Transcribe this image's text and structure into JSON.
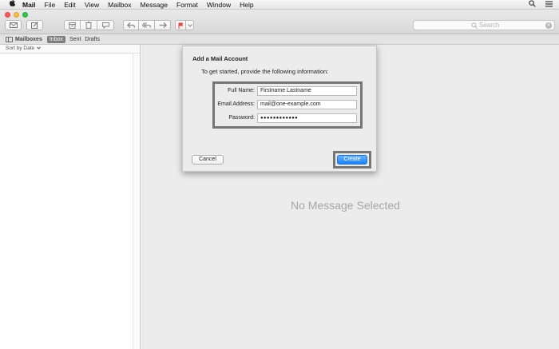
{
  "menubar": {
    "app_name": "Mail",
    "items": [
      "File",
      "Edit",
      "View",
      "Mailbox",
      "Message",
      "Format",
      "Window",
      "Help"
    ]
  },
  "search": {
    "placeholder": "Search"
  },
  "favorites": {
    "mailboxes_label": "Mailboxes",
    "inbox_label": "Inbox",
    "sent_label": "Sent",
    "drafts_label": "Drafts"
  },
  "message_list": {
    "sort_label": "Sort by Date"
  },
  "viewer": {
    "empty_text": "No Message Selected"
  },
  "dialog": {
    "title": "Add a Mail Account",
    "intro": "To get started, provide the following information:",
    "fields": {
      "full_name": {
        "label": "Full Name:",
        "value": "Firstname Lastname"
      },
      "email": {
        "label": "Email Address:",
        "value": "mail@one-example.com"
      },
      "password": {
        "label": "Password:",
        "value": "●●●●●●●●●●●●"
      }
    },
    "cancel_label": "Cancel",
    "create_label": "Create"
  },
  "colors": {
    "create_button": "#1a82f8",
    "highlight_border": "#767676",
    "close": "#fc5753",
    "minimize": "#fdbc40",
    "zoom": "#34c84a"
  },
  "icons": {
    "toolbar": [
      "get-mail-icon",
      "compose-icon",
      "archive-icon",
      "trash-icon",
      "junk-icon",
      "reply-icon",
      "reply-all-icon",
      "forward-icon",
      "flag-icon"
    ],
    "menubar_right": [
      "search-icon",
      "list-icon"
    ]
  }
}
